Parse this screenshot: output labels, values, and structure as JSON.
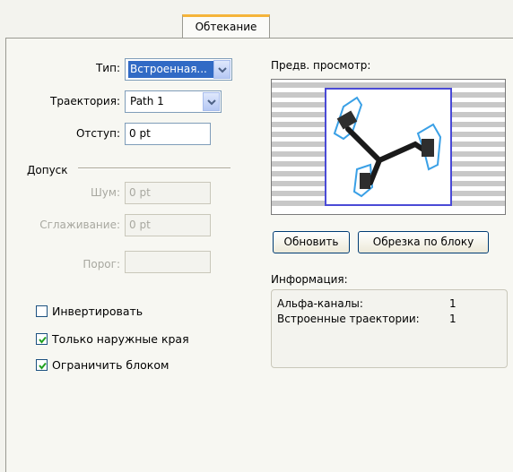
{
  "tab": {
    "label": "Обтекание"
  },
  "type": {
    "label": "Тип:",
    "value": "Встроенная..."
  },
  "path": {
    "label": "Траектория:",
    "value": "Path 1"
  },
  "offset": {
    "label": "Отступ:",
    "value": "0 pt"
  },
  "tolerance": {
    "section_label": "Допуск",
    "noise_label": "Шум:",
    "noise_value": "0 pt",
    "smooth_label": "Сглаживание:",
    "smooth_value": "0 pt",
    "threshold_label": "Порог:",
    "threshold_value": ""
  },
  "checkboxes": {
    "invert": {
      "label": "Инвертировать",
      "checked": false
    },
    "outside_edges": {
      "label": "Только наружные края",
      "checked": true
    },
    "restrict_frame": {
      "label": "Ограничить блоком",
      "checked": true
    }
  },
  "preview": {
    "label": "Предв. просмотр:"
  },
  "buttons": {
    "update": "Обновить",
    "crop_frame": "Обрезка по блоку"
  },
  "info": {
    "label": "Информация:",
    "alpha_label": "Альфа-каналы:",
    "alpha_value": "1",
    "paths_label": "Встроенные траектории:",
    "paths_value": "1"
  },
  "colors": {
    "accent_tab": "#f5b43a",
    "selection": "#316ac5",
    "frame": "#4a4ad6",
    "check": "#21a121"
  }
}
